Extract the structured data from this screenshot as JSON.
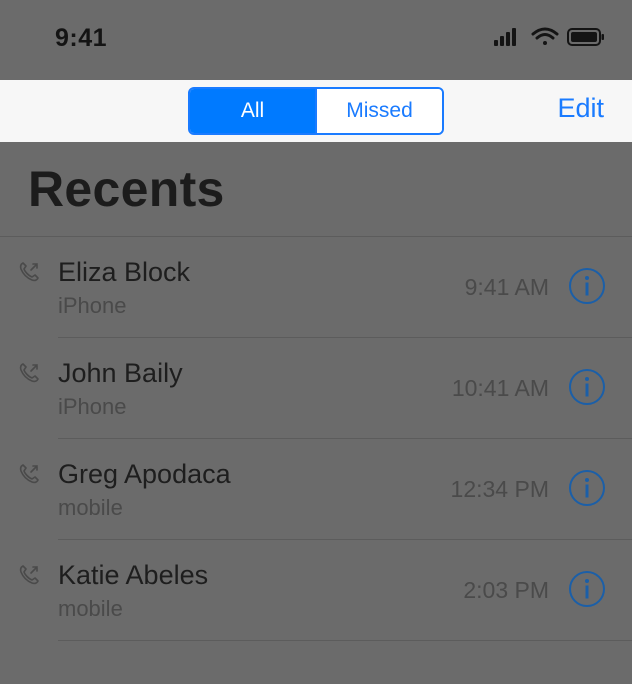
{
  "status_bar": {
    "time": "9:41",
    "icons": [
      "signal-icon",
      "wifi-icon",
      "battery-icon"
    ]
  },
  "nav": {
    "segments": [
      "All",
      "Missed"
    ],
    "selected_segment": "All",
    "edit_label": "Edit"
  },
  "title": "Recents",
  "calls": [
    {
      "name": "Eliza Block",
      "type": "iPhone",
      "time": "9:41 AM"
    },
    {
      "name": "John Baily",
      "type": "iPhone",
      "time": "10:41 AM"
    },
    {
      "name": "Greg Apodaca",
      "type": "mobile",
      "time": "12:34 PM"
    },
    {
      "name": "Katie Abeles",
      "type": "mobile",
      "time": "2:03 PM"
    }
  ],
  "colors": {
    "accent": "#007aff",
    "overlay_background": "#6b6b6b",
    "highlight_background": "#f7f7f7"
  }
}
